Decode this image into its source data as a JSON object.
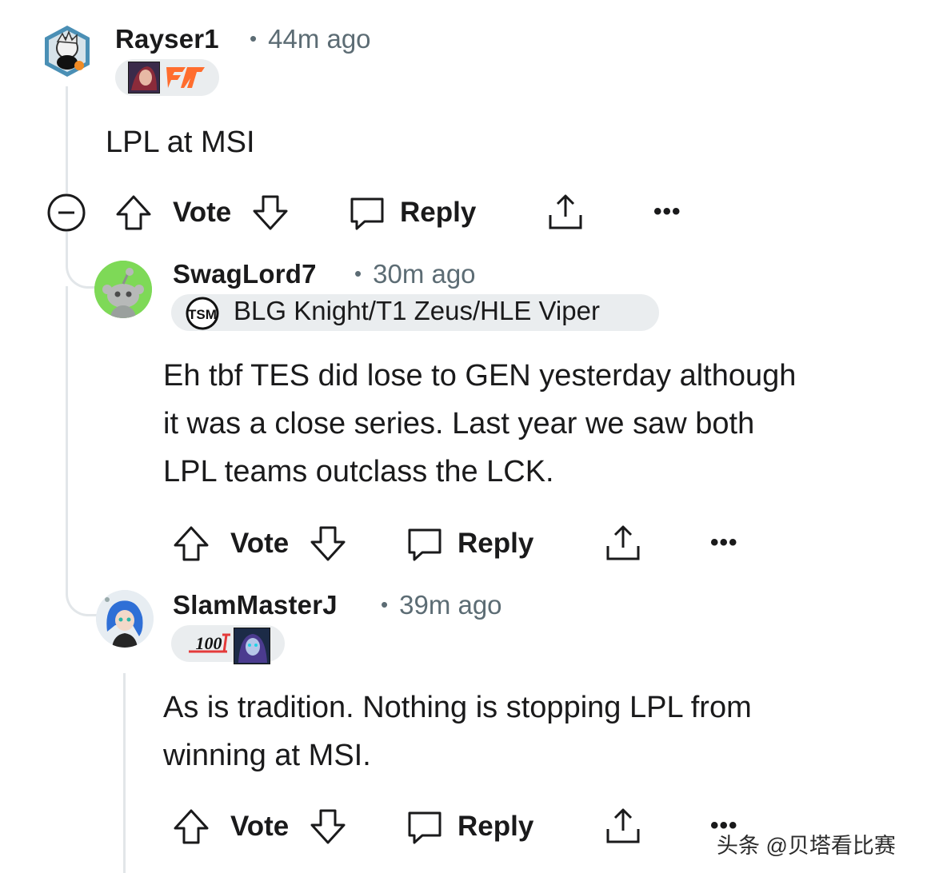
{
  "comments": [
    {
      "username": "Rayser1",
      "time": "44m ago",
      "body": "LPL at MSI",
      "flair_icons": [
        "champion-portrait-icon",
        "fnatic-logo-icon"
      ],
      "actions": {
        "vote": "Vote",
        "reply": "Reply"
      }
    },
    {
      "username": "SwagLord7",
      "time": "30m ago",
      "flair_text": "BLG Knight/T1 Zeus/HLE Viper",
      "flair_icons": [
        "tsm-logo-icon"
      ],
      "body_lines": [
        "Eh tbf TES did lose to GEN yesterday although",
        "it was a close series. Last year we saw both",
        "LPL teams outclass the LCK."
      ],
      "actions": {
        "vote": "Vote",
        "reply": "Reply"
      }
    },
    {
      "username": "SlamMasterJ",
      "time": "39m ago",
      "flair_icons": [
        "100-thieves-logo-icon",
        "champion-portrait-icon"
      ],
      "body_lines": [
        "As is tradition. Nothing is stopping LPL from",
        "winning at MSI."
      ],
      "actions": {
        "vote": "Vote",
        "reply": "Reply"
      }
    }
  ],
  "watermark": "头条 @贝塔看比赛",
  "colors": {
    "text": "#1a1a1b",
    "meta": "#5c6c74",
    "flair_bg": "#eaedef",
    "thread_line": "#e2e6e9"
  }
}
